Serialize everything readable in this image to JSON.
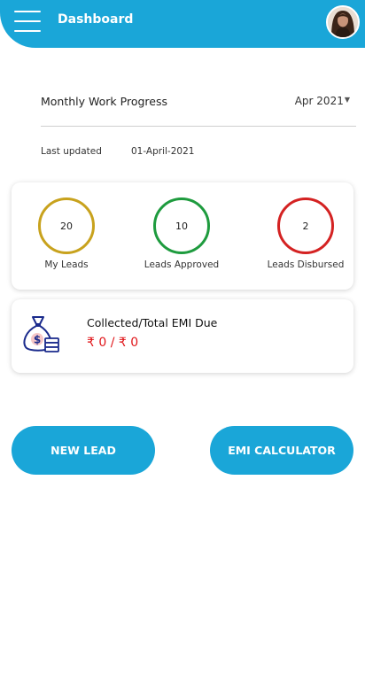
{
  "header": {
    "title": "Dashboard",
    "menu_icon": "hamburger-menu-icon",
    "avatar": "user-avatar",
    "color": "#1aa6d8"
  },
  "progress": {
    "title": "Monthly Work Progress",
    "month": "Apr 2021",
    "updated_label": "Last updated",
    "updated_value": "01-April-2021"
  },
  "stats": [
    {
      "value": "20",
      "label": "My Leads",
      "color": "#c8a21d"
    },
    {
      "value": "10",
      "label": "Leads Approved",
      "color": "#1e9b3e"
    },
    {
      "value": "2",
      "label": "Leads Disbursed",
      "color": "#d42222"
    }
  ],
  "emi": {
    "title": "Collected/Total EMI Due",
    "amount": "₹ 0 / ₹ 0",
    "icon": "money-bag-icon",
    "amount_color": "#e0161a"
  },
  "actions": {
    "new_lead": "NEW LEAD",
    "emi_calculator": "EMI CALCULATOR"
  }
}
